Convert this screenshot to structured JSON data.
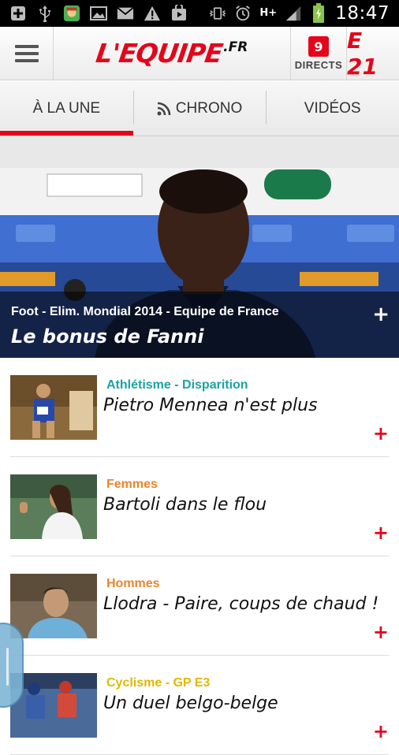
{
  "status_bar": {
    "time": "18:47",
    "network": "H+",
    "icons": [
      "add-icon",
      "usb-icon",
      "app-icon",
      "image-icon",
      "gmail-icon",
      "warning-icon",
      "play-store-icon",
      "vibrate-icon",
      "alarm-icon",
      "signal-icon",
      "battery-icon"
    ]
  },
  "header": {
    "logo_main": "L'EQUIPE",
    "logo_suffix": ".FR",
    "directs_count": "9",
    "directs_label": "DIRECTS",
    "e21_label": "E 21",
    "accent_color": "#e3061b"
  },
  "tabs": [
    {
      "label": "À LA UNE",
      "active": true
    },
    {
      "label": "CHRONO",
      "active": false,
      "icon": "rss-icon"
    },
    {
      "label": "VIDÉOS",
      "active": false
    }
  ],
  "hero": {
    "category": "Foot - Elim. Mondial 2014 - Equipe de France",
    "title": "Le bonus de Fanni",
    "plus": "+"
  },
  "articles": [
    {
      "category": "Athlétisme - Disparition",
      "category_color": "#1aa3a3",
      "title": "Pietro Mennea n'est plus",
      "plus": "+"
    },
    {
      "category": "Femmes",
      "category_color": "#e8862a",
      "title": "Bartoli dans le flou",
      "plus": "+"
    },
    {
      "category": "Hommes",
      "category_color": "#e8862a",
      "title": "Llodra - Paire, coups de chaud !",
      "plus": "+"
    },
    {
      "category": "Cyclisme - GP E3",
      "category_color": "#e0b800",
      "title": "Un duel belgo-belge",
      "plus": "+"
    }
  ]
}
